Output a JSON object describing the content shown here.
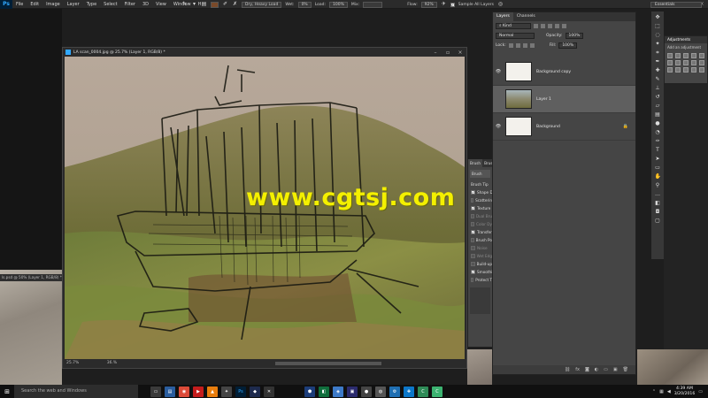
{
  "app": {
    "logo": "Ps"
  },
  "menu": [
    "File",
    "Edit",
    "Image",
    "Layer",
    "Type",
    "Select",
    "Filter",
    "3D",
    "View",
    "Window",
    "H"
  ],
  "options": {
    "brush_preset": "Dry, Heavy Load",
    "wet_label": "Wet:",
    "wet_value": "0%",
    "load_label": "Load:",
    "load_value": "100%",
    "mix_label": "Mix:",
    "mix_value": "",
    "flow_label": "Flow:",
    "flow_value": "92%",
    "sample_all_layers": "Sample All Layers",
    "workspace": "Essentials"
  },
  "document": {
    "title": "LA scan_0004.jpg @ 25.7% (Layer 1, RGB/8) *",
    "zoom": "25.7%",
    "status": "36.%",
    "other_doc_tab": "ls.psd @ 50% (Layer 1, RGB/8) *"
  },
  "brush_panel": {
    "tabs": [
      "Brush",
      "Brush"
    ],
    "presets_button": "Brush",
    "rows": [
      {
        "label": "Brush Tip",
        "check": false,
        "dim": false,
        "show_check": false
      },
      {
        "label": "Shape D",
        "check": true,
        "dim": false,
        "show_check": true
      },
      {
        "label": "Scatterin",
        "check": false,
        "dim": false,
        "show_check": true
      },
      {
        "label": "Texture",
        "check": true,
        "dim": false,
        "show_check": true
      },
      {
        "label": "Dual Bru",
        "check": false,
        "dim": true,
        "show_check": true
      },
      {
        "label": "Color Dy",
        "check": false,
        "dim": true,
        "show_check": true
      },
      {
        "label": "Transfer",
        "check": true,
        "dim": false,
        "show_check": true
      },
      {
        "label": "Brush Po",
        "check": false,
        "dim": false,
        "show_check": true
      },
      {
        "label": "Noise",
        "check": false,
        "dim": true,
        "show_check": true
      },
      {
        "label": "Wet Edg",
        "check": false,
        "dim": true,
        "show_check": true
      },
      {
        "label": "Build-up",
        "check": false,
        "dim": false,
        "show_check": true
      },
      {
        "label": "Smoothin",
        "check": true,
        "dim": false,
        "show_check": true
      },
      {
        "label": "Protect T",
        "check": false,
        "dim": false,
        "show_check": true
      }
    ]
  },
  "layers_panel": {
    "tabs": [
      "Layers",
      "Channels"
    ],
    "filter_kind": "Kind",
    "blend_mode": "Normal",
    "opacity_label": "Opacity:",
    "opacity_value": "100%",
    "lock_label": "Lock:",
    "fill_label": "Fill:",
    "fill_value": "100%",
    "layers": [
      {
        "name": "Background copy",
        "visible": true,
        "selected": false,
        "thumb": "sketch",
        "locked": false
      },
      {
        "name": "Layer 1",
        "visible": false,
        "selected": true,
        "thumb": "paint",
        "locked": false
      },
      {
        "name": "Background",
        "visible": true,
        "selected": false,
        "thumb": "sketch",
        "locked": true
      }
    ],
    "footer_icons": [
      "link-icon",
      "fx-icon",
      "mask-icon",
      "adjustment-icon",
      "folder-icon",
      "new-layer-icon",
      "trash-icon"
    ]
  },
  "adjustments": {
    "tab": "Adjustments",
    "label": "Add an adjustment"
  },
  "taskbar": {
    "search_placeholder": "Search the web and Windows",
    "time": "4:39 AM",
    "date": "3/20/2016"
  },
  "watermark": "www.cgtsj.com"
}
